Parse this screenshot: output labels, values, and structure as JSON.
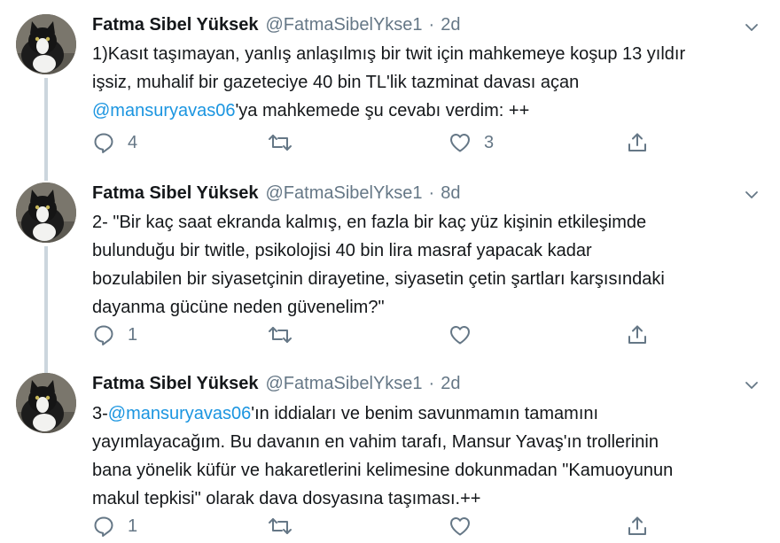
{
  "colors": {
    "text": "#14171a",
    "secondary": "#657786",
    "link": "#1b95e0",
    "thread_line": "#ccd6dd"
  },
  "icons": {
    "reply": "reply-icon",
    "retweet": "retweet-icon",
    "like": "heart-icon",
    "share": "share-icon",
    "menu": "chevron-down-icon",
    "avatar": "cat-avatar"
  },
  "tweets": [
    {
      "name": "Fatma Sibel Yüksek",
      "handle": "@FatmaSibelYkse1",
      "separator": "·",
      "time": "2d",
      "lines": [
        [
          {
            "text": "1)Kasıt taşımayan, yanlış anlaşılmış bir twit için mahkemeye koşup 13 yıldır"
          }
        ],
        [
          {
            "text": "işsiz, muhalif bir gazeteciye 40 bin TL'lik tazminat davası açan"
          }
        ],
        [
          {
            "text": "@mansuryavas06",
            "mention": true
          },
          {
            "text": "'ya mahkemede şu cevabı verdim: ++"
          }
        ]
      ],
      "reply_count": "4",
      "retweet_count": "",
      "like_count": "3"
    },
    {
      "name": "Fatma Sibel Yüksek",
      "handle": "@FatmaSibelYkse1",
      "separator": "·",
      "time": "8d",
      "lines": [
        [
          {
            "text": "2- \"Bir kaç saat ekranda kalmış, en fazla bir kaç yüz kişinin etkileşimde"
          }
        ],
        [
          {
            "text": "bulunduğu bir twitle, psikolojisi 40 bin lira masraf yapacak kadar"
          }
        ],
        [
          {
            "text": "bozulabilen bir siyasetçinin dirayetine, siyasetin çetin şartları karşısındaki"
          }
        ],
        [
          {
            "text": "dayanma gücüne neden güvenelim?\""
          }
        ]
      ],
      "reply_count": "1",
      "retweet_count": "",
      "like_count": ""
    },
    {
      "name": "Fatma Sibel Yüksek",
      "handle": "@FatmaSibelYkse1",
      "separator": "·",
      "time": "2d",
      "lines": [
        [
          {
            "text": "3-"
          },
          {
            "text": "@mansuryavas06",
            "mention": true
          },
          {
            "text": "'ın iddiaları ve benim savunmamın tamamını"
          }
        ],
        [
          {
            "text": "yayımlayacağım. Bu davanın en vahim tarafı, Mansur Yavaş'ın trollerinin"
          }
        ],
        [
          {
            "text": "bana yönelik küfür ve hakaretlerini kelimesine dokunmadan \"Kamuoyunun"
          }
        ],
        [
          {
            "text": "makul tepkisi\" olarak dava dosyasına taşıması.++"
          }
        ]
      ],
      "reply_count": "1",
      "retweet_count": "",
      "like_count": ""
    }
  ]
}
